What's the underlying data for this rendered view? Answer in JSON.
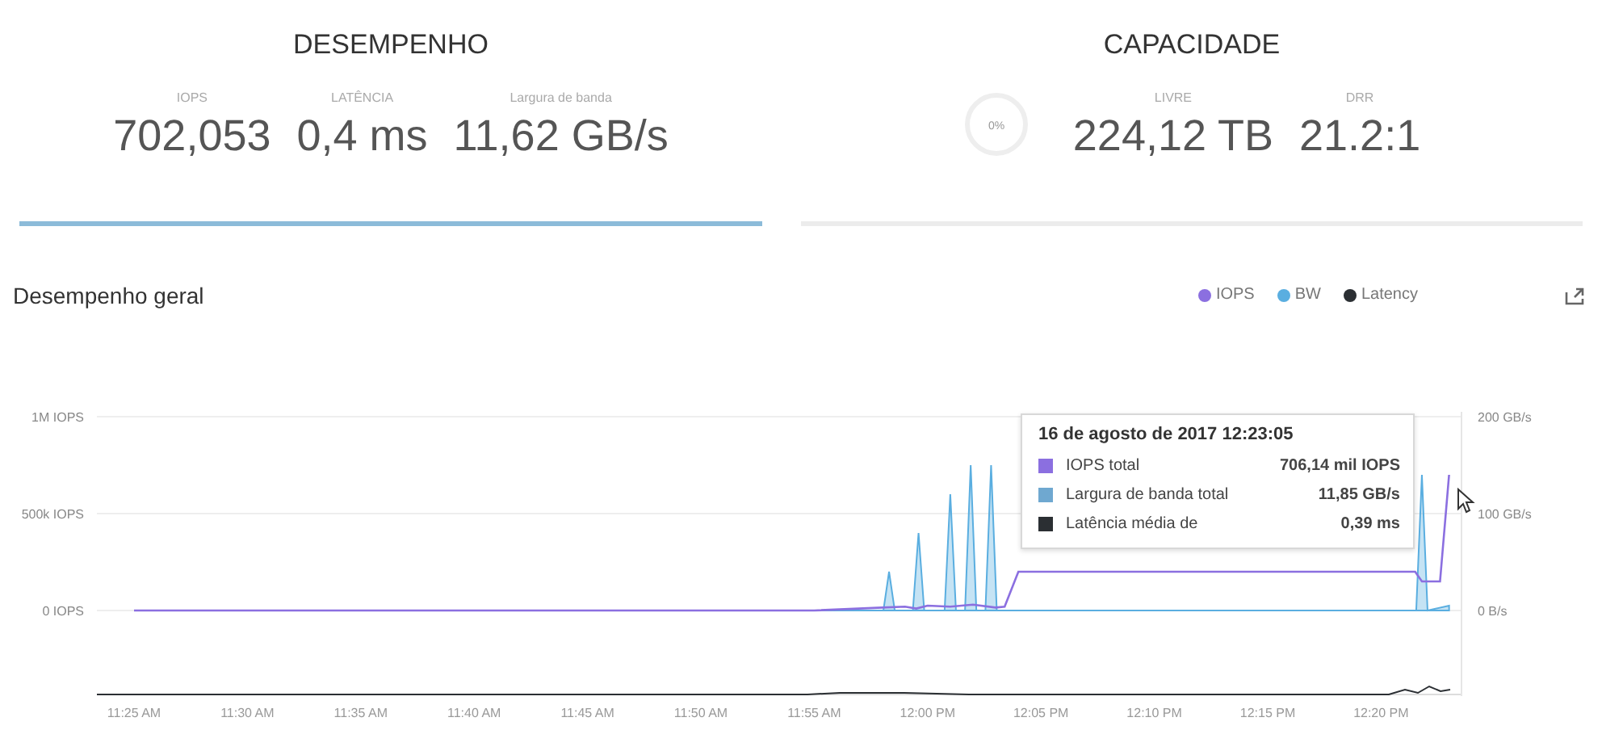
{
  "performance": {
    "title": "DESEMPENHO",
    "selected": true,
    "metrics": [
      {
        "label": "IOPS",
        "value": "702,053"
      },
      {
        "label": "LATÊNCIA",
        "value": "0,4 ms"
      },
      {
        "label": "Largura de banda",
        "value": "11,62 GB/s"
      }
    ]
  },
  "capacity": {
    "title": "CAPACIDADE",
    "selected": false,
    "usage_ring": {
      "label": "0%",
      "level": 0
    },
    "metrics": [
      {
        "label": "LIVRE",
        "value": "224,12 TB"
      },
      {
        "label": "DRR",
        "value": "21.2:1"
      }
    ]
  },
  "overview": {
    "title": "Desempenho geral",
    "latency_legend": {
      "label": "Latency",
      "color": "#2b2f33"
    },
    "right_axis_labels": [
      "200 GB/s",
      "100 GB/s",
      "0 B/s"
    ],
    "x_axis_labels": [
      "11:25 AM",
      "11:30 AM",
      "11:35 AM",
      "11:40 AM",
      "11:45 AM",
      "11:50 AM",
      "11:55 AM",
      "12:00 PM",
      "12:05 PM",
      "12:10 PM",
      "12:15 PM",
      "12:20 PM"
    ],
    "y_axis_labels": [
      "1M IOPS",
      "500k IOPS",
      "0 IOPS"
    ],
    "series": [
      {
        "name": "IOPS",
        "color": "#8b6fe0"
      },
      {
        "name": "BW",
        "color": "#5aaee0"
      }
    ],
    "tooltip": {
      "title": "16 de agosto de 2017 12:23:05",
      "rows": [
        {
          "label": "IOPS total",
          "value": "706,14 mil IOPS",
          "color": "#8b6fe0"
        },
        {
          "label": "Largura de banda total",
          "value": "11,85 GB/s",
          "color": "#6fa8d0"
        },
        {
          "label": "Latência média de",
          "value": "0,39 ms",
          "color": "#2b2f33"
        }
      ]
    }
  }
}
